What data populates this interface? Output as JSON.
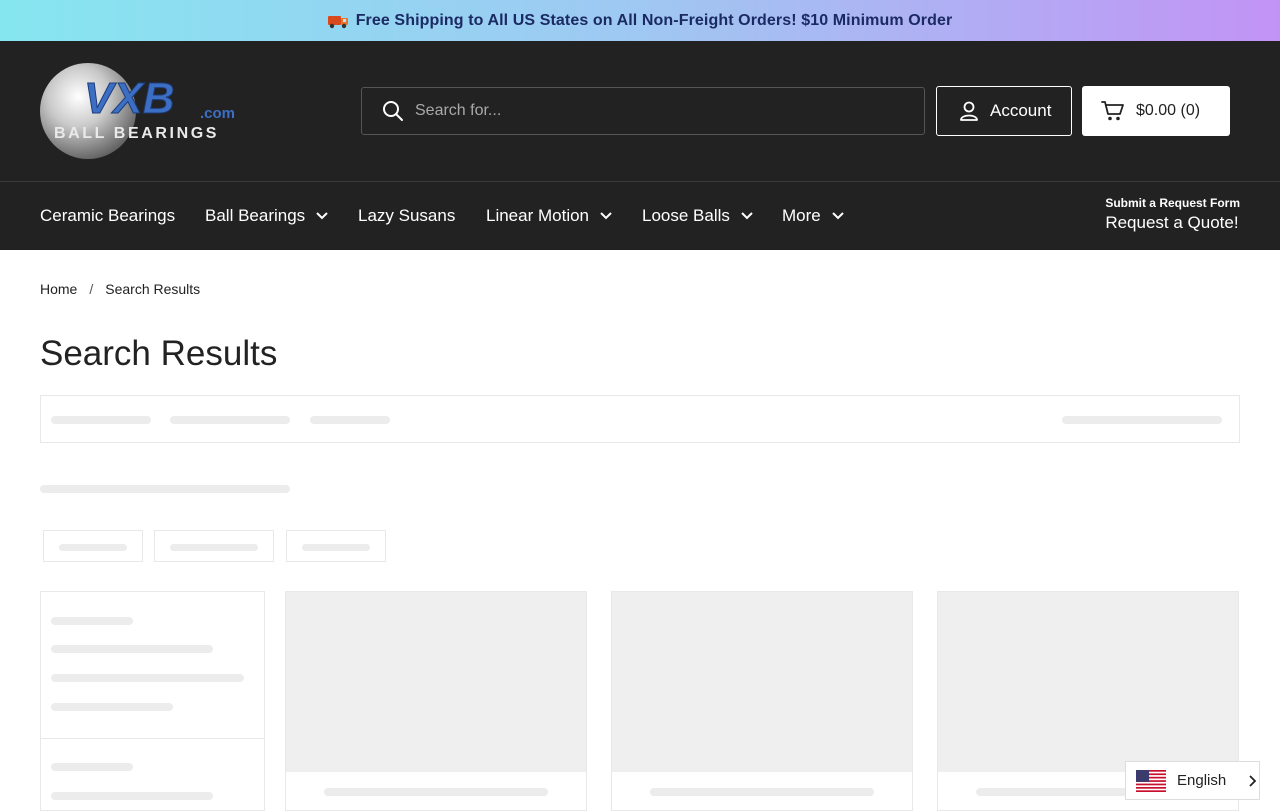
{
  "announcement": {
    "text": "Free Shipping to All US States on All Non-Freight Orders! $10 Minimum Order",
    "icon": "truck-icon"
  },
  "header": {
    "logo": {
      "main": "VXB",
      "suffix": ".com",
      "tagline": "BALL BEARINGS"
    },
    "search": {
      "placeholder": "Search for..."
    },
    "account": {
      "label": "Account"
    },
    "cart": {
      "label": "$0.00 (0)"
    }
  },
  "nav": {
    "items": [
      {
        "label": "Ceramic Bearings",
        "has_dropdown": false
      },
      {
        "label": "Ball Bearings",
        "has_dropdown": true
      },
      {
        "label": "Lazy Susans",
        "has_dropdown": false
      },
      {
        "label": "Linear Motion",
        "has_dropdown": true
      },
      {
        "label": "Loose Balls",
        "has_dropdown": true
      },
      {
        "label": "More",
        "has_dropdown": true
      }
    ],
    "quote": {
      "small": "Submit a Request Form",
      "big": "Request a Quote!"
    }
  },
  "breadcrumb": {
    "home": "Home",
    "separator": "/",
    "current": "Search Results"
  },
  "page_title": "Search Results",
  "language": {
    "label": "English"
  },
  "colors": {
    "header_bg": "#222222",
    "skeleton": "#ececec",
    "banner_text": "#1b2a63"
  }
}
